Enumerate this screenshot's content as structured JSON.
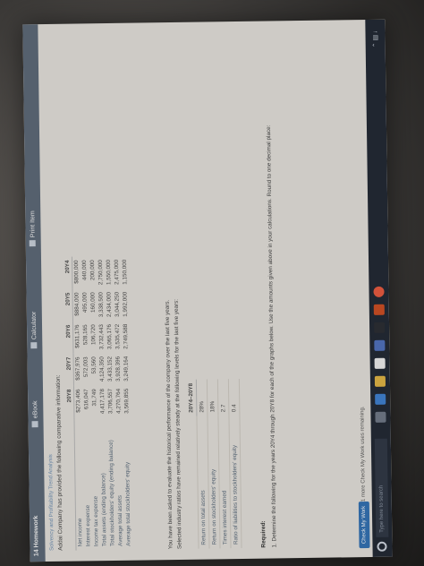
{
  "app": {
    "title": "14 Homework",
    "tools": [
      "eBook",
      "Calculator",
      "Print Item"
    ]
  },
  "breadcrumb": "Solvency and Profitability Trend Analysis",
  "intro": "Addai Company has provided the following comparative information:",
  "comparative": {
    "columns": [
      "20Y8",
      "20Y7",
      "20Y6",
      "20Y5",
      "20Y4"
    ],
    "rows": [
      {
        "label": "Net income",
        "values": [
          "$273,406",
          "$367,976",
          "$631,176",
          "$884,000",
          "$800,000"
        ]
      },
      {
        "label": "Interest expense",
        "values": [
          "616,047",
          "572,003",
          "528,165",
          "495,000",
          "440,000"
        ]
      },
      {
        "label": "Income tax expense",
        "values": [
          "31,749",
          "53,560",
          "106,720",
          "160,000",
          "200,000"
        ]
      },
      {
        "label": "Total assets (ending balance)",
        "values": [
          "4,417,178",
          "4,124,350",
          "3,732,443",
          "3,338,500",
          "2,750,000"
        ]
      },
      {
        "label": "Total stockholders' equity (ending balance)",
        "values": [
          "3,706,557",
          "3,433,152",
          "3,065,176",
          "2,434,000",
          "1,550,000"
        ]
      },
      {
        "label": "Average total assets",
        "values": [
          "4,270,764",
          "3,928,396",
          "3,535,472",
          "3,044,250",
          "2,475,000"
        ]
      },
      {
        "label": "Average total stockholders' equity",
        "values": [
          "3,569,855",
          "3,249,164",
          "2,749,588",
          "1,992,000",
          "1,150,000"
        ]
      }
    ]
  },
  "note1": "You have been asked to evaluate the historical performance of the company over the last five years.",
  "note2": "Selected industry ratios have remained relatively steady at the following levels for the last five years:",
  "industry": {
    "header": "20Y4–20Y8",
    "rows": [
      {
        "label": "Return on total assets",
        "value": "28%"
      },
      {
        "label": "Return on stockholders' equity",
        "value": "18%"
      },
      {
        "label": "Times interest earned",
        "value": "2.7"
      },
      {
        "label": "Ratio of liabilities to stockholders' equity",
        "value": "0.4"
      }
    ]
  },
  "required": {
    "label": "Required:",
    "text": "1. Determine the following for the years 20Y4 through 20Y8 for each of the graphs below. Use the amounts given above in your calculations. Round to one decimal place:"
  },
  "footer": {
    "check_button": "Check My Work",
    "check_note": "1 more Check My Work uses remaining."
  },
  "taskbar": {
    "search_placeholder": "Type here to search"
  }
}
